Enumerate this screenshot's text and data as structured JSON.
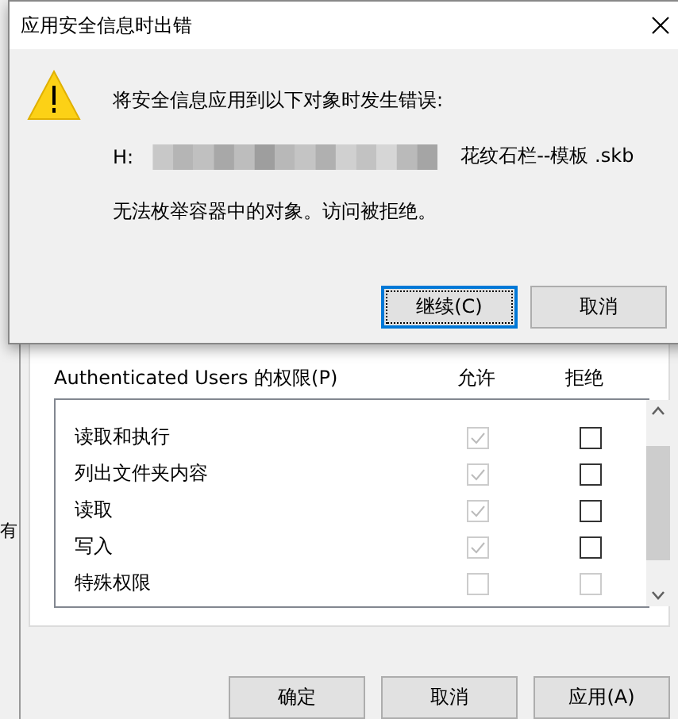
{
  "background_window": {
    "left_edge_text": "有",
    "permissions": {
      "label": "Authenticated Users 的权限(P)",
      "columns": [
        "允许",
        "拒绝"
      ],
      "rows": [
        {
          "name": "读取和执行",
          "allow": {
            "checked": true,
            "disabled": true
          },
          "deny": {
            "checked": false,
            "disabled": false
          }
        },
        {
          "name": "列出文件夹内容",
          "allow": {
            "checked": true,
            "disabled": true
          },
          "deny": {
            "checked": false,
            "disabled": false
          }
        },
        {
          "name": "读取",
          "allow": {
            "checked": true,
            "disabled": true
          },
          "deny": {
            "checked": false,
            "disabled": false
          }
        },
        {
          "name": "写入",
          "allow": {
            "checked": true,
            "disabled": true
          },
          "deny": {
            "checked": false,
            "disabled": false
          }
        },
        {
          "name": "特殊权限",
          "allow": {
            "checked": false,
            "disabled": true
          },
          "deny": {
            "checked": false,
            "disabled": true
          }
        }
      ]
    },
    "buttons": [
      "确定",
      "取消",
      "应用(A)"
    ]
  },
  "error_dialog": {
    "title": "应用安全信息时出错",
    "message": "将安全信息应用到以下对象时发生错误:",
    "path_prefix": "H:",
    "path_suffix": "花纹石栏--模板  .skb",
    "detail": "无法枚举容器中的对象。访问被拒绝。",
    "buttons": [
      {
        "label": "继续(C)",
        "focused": true
      },
      {
        "label": "取消",
        "focused": false
      }
    ]
  }
}
